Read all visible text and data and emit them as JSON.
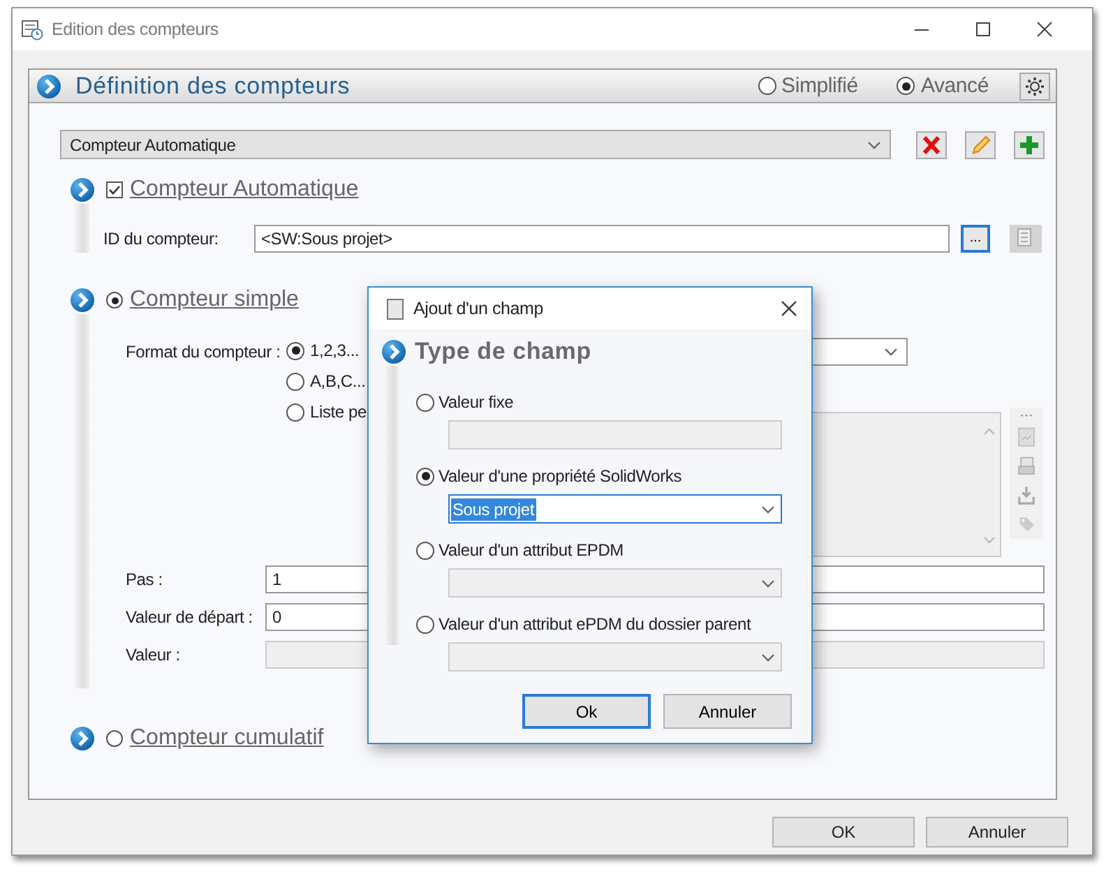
{
  "window": {
    "title": "Edition des compteurs"
  },
  "panel": {
    "title": "Définition des compteurs",
    "modes": [
      {
        "label": "Simplifié",
        "selected": false
      },
      {
        "label": "Avancé",
        "selected": true
      }
    ]
  },
  "counter_select": {
    "value": "Compteur Automatique"
  },
  "sections": [
    {
      "kind": "checkbox",
      "title": "Compteur Automatique",
      "checked": true,
      "id_field": {
        "label": "ID du compteur:",
        "value": "<SW:Sous projet>",
        "browse_button": "..."
      }
    },
    {
      "kind": "radio",
      "title": "Compteur simple",
      "selected": true,
      "format": {
        "label": "Format du compteur :",
        "options": [
          {
            "label": "1,2,3...",
            "selected": true
          },
          {
            "label": "A,B,C...",
            "selected": false
          },
          {
            "label": "Liste pe",
            "selected": false
          }
        ]
      },
      "fields": [
        {
          "label": "Pas :",
          "value": "1",
          "disabled": false
        },
        {
          "label": "Valeur de départ :",
          "value": "0",
          "disabled": false
        },
        {
          "label": "Valeur :",
          "disabled": true
        }
      ]
    },
    {
      "kind": "radio",
      "title": "Compteur cumulatif",
      "selected": false
    }
  ],
  "buttons": [
    "OK",
    "Annuler"
  ],
  "dialog": {
    "title": "Ajout d'un champ",
    "heading": "Type de champ",
    "options": [
      {
        "label": "Valeur fixe",
        "selected": false,
        "kind": "text",
        "disabled": true
      },
      {
        "label": "Valeur d'une propriété SolidWorks",
        "selected": true,
        "kind": "combo",
        "disabled": false,
        "value": "Sous projet"
      },
      {
        "label": "Valeur d'un attribut EPDM",
        "selected": false,
        "kind": "combo",
        "disabled": true
      },
      {
        "label": "Valeur d'un attribut ePDM du dossier parent",
        "selected": false,
        "kind": "combo",
        "disabled": true
      }
    ],
    "buttons": [
      "Ok",
      "Annuler"
    ]
  }
}
